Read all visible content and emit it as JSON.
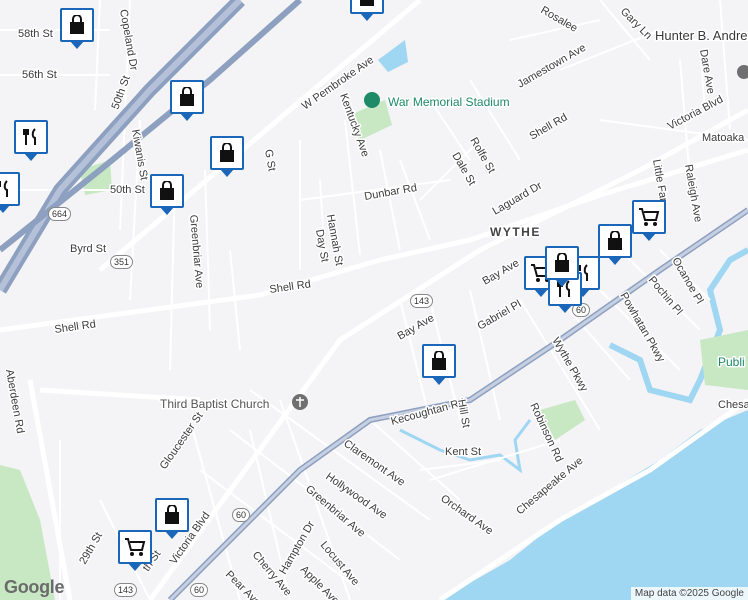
{
  "colors": {
    "water": "#9fd6f1",
    "park": "#c7e8c3",
    "highway": "#8ea0bf",
    "arterial": "#ffffff",
    "pin_border": "#1a66b8",
    "poi_green": "#1e8a66"
  },
  "area_label": "WYTHE",
  "pois": {
    "stadium": "War Memorial Stadium",
    "church": "Third Baptist Church",
    "school": "Hunter B. Andre",
    "park_partial": "Publi"
  },
  "streets": [
    "58th St",
    "56th St",
    "50th St",
    "50th St",
    "Copeland Dr",
    "Kiwanis St",
    "G St",
    "W Pembroke Ave",
    "Kentucky Ave",
    "Hannah St",
    "Day St",
    "Dunbar Rd",
    "Rolfe St",
    "Dale St",
    "Laguard Dr",
    "Shell Rd",
    "Shell Rd",
    "Shell Rd",
    "Victoria Blvd",
    "Victoria Blvd",
    "Byrd St",
    "Greenbriar Ave",
    "Aberdeen Rd",
    "Jamestown Ave",
    "Rosalee",
    "Gary Ln",
    "Dare Ave",
    "Raleigh Ave",
    "Little Far",
    "Matoaka",
    "Bay Ave",
    "Bay Ave",
    "Gabriel Pl",
    "Powhatan Pkwy",
    "Pochin Pl",
    "Ocanoe Pl",
    "Wythe Pkwy",
    "Kecoughtan Rd",
    "Hill St",
    "Kent St",
    "Robinson Rd",
    "Claremont Ave",
    "Hollywood Ave",
    "Greenbriar Ave",
    "Orchard Ave",
    "Chesapeake Ave",
    "Gloucester St",
    "Hampton Dr",
    "Locust Ave",
    "Cherry Ave",
    "Apple Ave",
    "Pear Ave",
    "29th St",
    "Chesa",
    "th St"
  ],
  "route_shields": [
    "664",
    "351",
    "143",
    "143",
    "60",
    "60",
    "60"
  ],
  "pins": [
    {
      "type": "shopping-bag"
    },
    {
      "type": "shopping-bag"
    },
    {
      "type": "restaurant"
    },
    {
      "type": "restaurant"
    },
    {
      "type": "shopping-bag"
    },
    {
      "type": "shopping-bag"
    },
    {
      "type": "shopping-bag"
    },
    {
      "type": "grocery-cart"
    },
    {
      "type": "shopping-bag"
    },
    {
      "type": "grocery-cart"
    },
    {
      "type": "restaurant"
    },
    {
      "type": "restaurant"
    },
    {
      "type": "shopping-bag"
    },
    {
      "type": "shopping-bag"
    },
    {
      "type": "grocery-cart"
    },
    {
      "type": "shopping-bag"
    }
  ],
  "branding": "Google",
  "attribution": "Map data ©2025 Google"
}
